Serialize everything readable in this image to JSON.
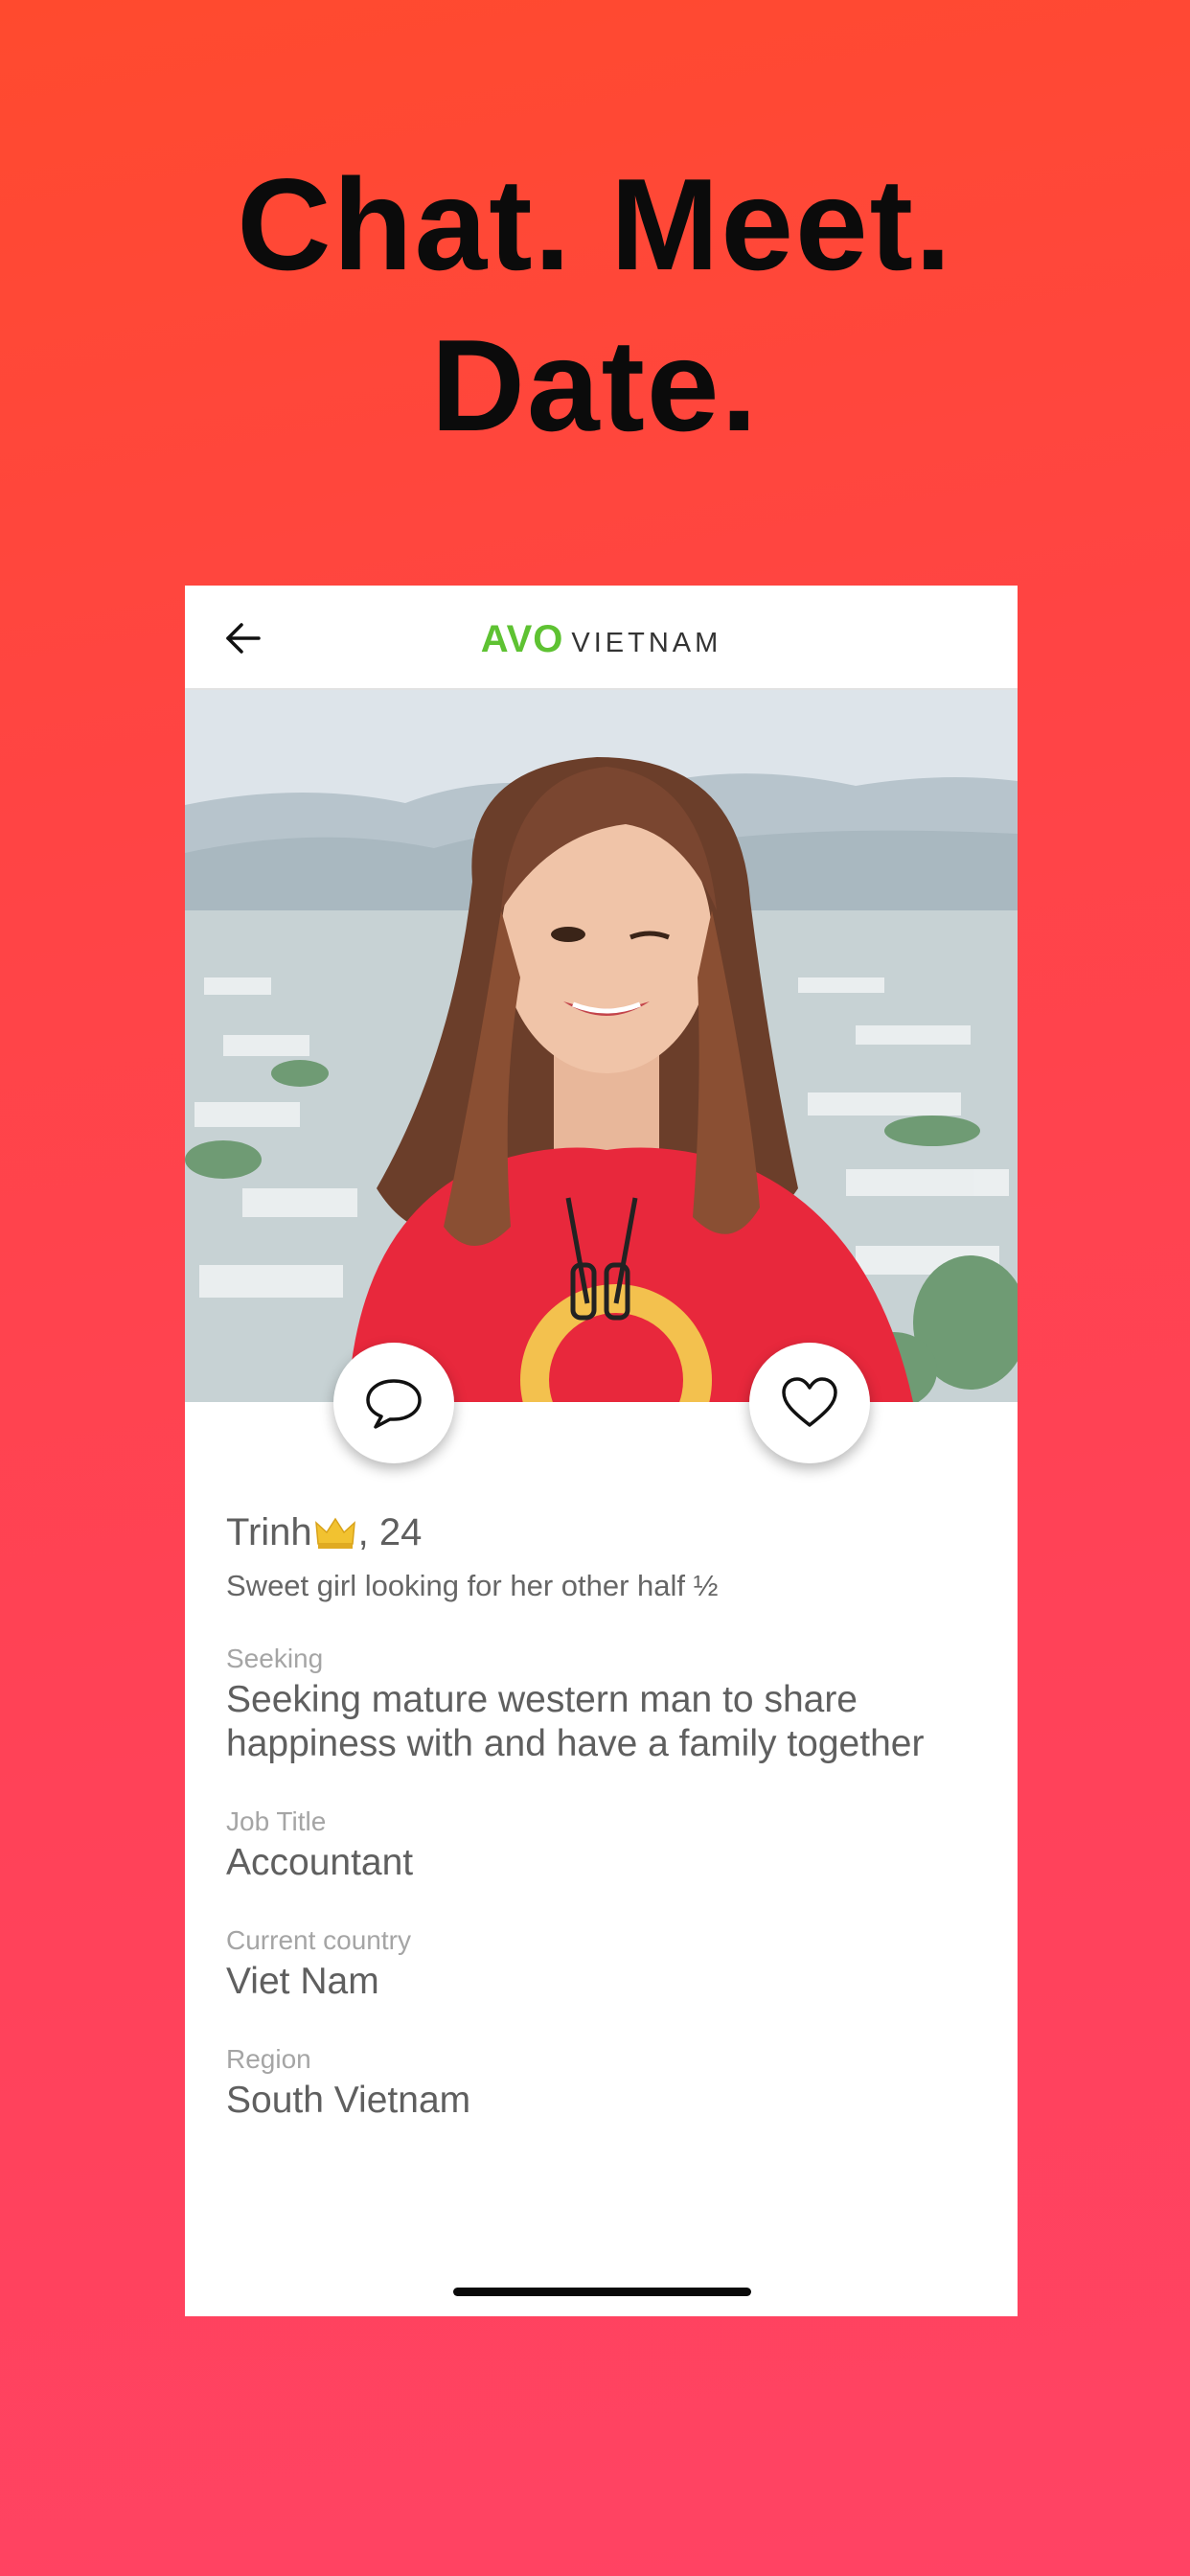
{
  "headline": {
    "line1": "Chat. Meet.",
    "line2": "Date."
  },
  "navbar": {
    "back_icon": "arrow-left-icon",
    "brand_primary": "AVO",
    "brand_secondary": "VIETNAM",
    "brand_color": "#5ec232"
  },
  "profile": {
    "photo_description_icon": "profile-photo",
    "name": "Trinh",
    "badge_icon": "crown-icon",
    "age": ", 24",
    "tagline": "Sweet girl looking for her other half ½",
    "fields": [
      {
        "label": "Seeking",
        "value": "Seeking mature western man to share happiness with and have a family together"
      },
      {
        "label": "Job Title",
        "value": "Accountant"
      },
      {
        "label": "Current country",
        "value": "Viet Nam"
      },
      {
        "label": "Region",
        "value": "South Vietnam"
      }
    ]
  },
  "actions": {
    "chat_icon": "chat-bubble-icon",
    "like_icon": "heart-icon"
  },
  "colors": {
    "background_top": "#ff4a2e",
    "background_bottom": "#ff4364"
  }
}
